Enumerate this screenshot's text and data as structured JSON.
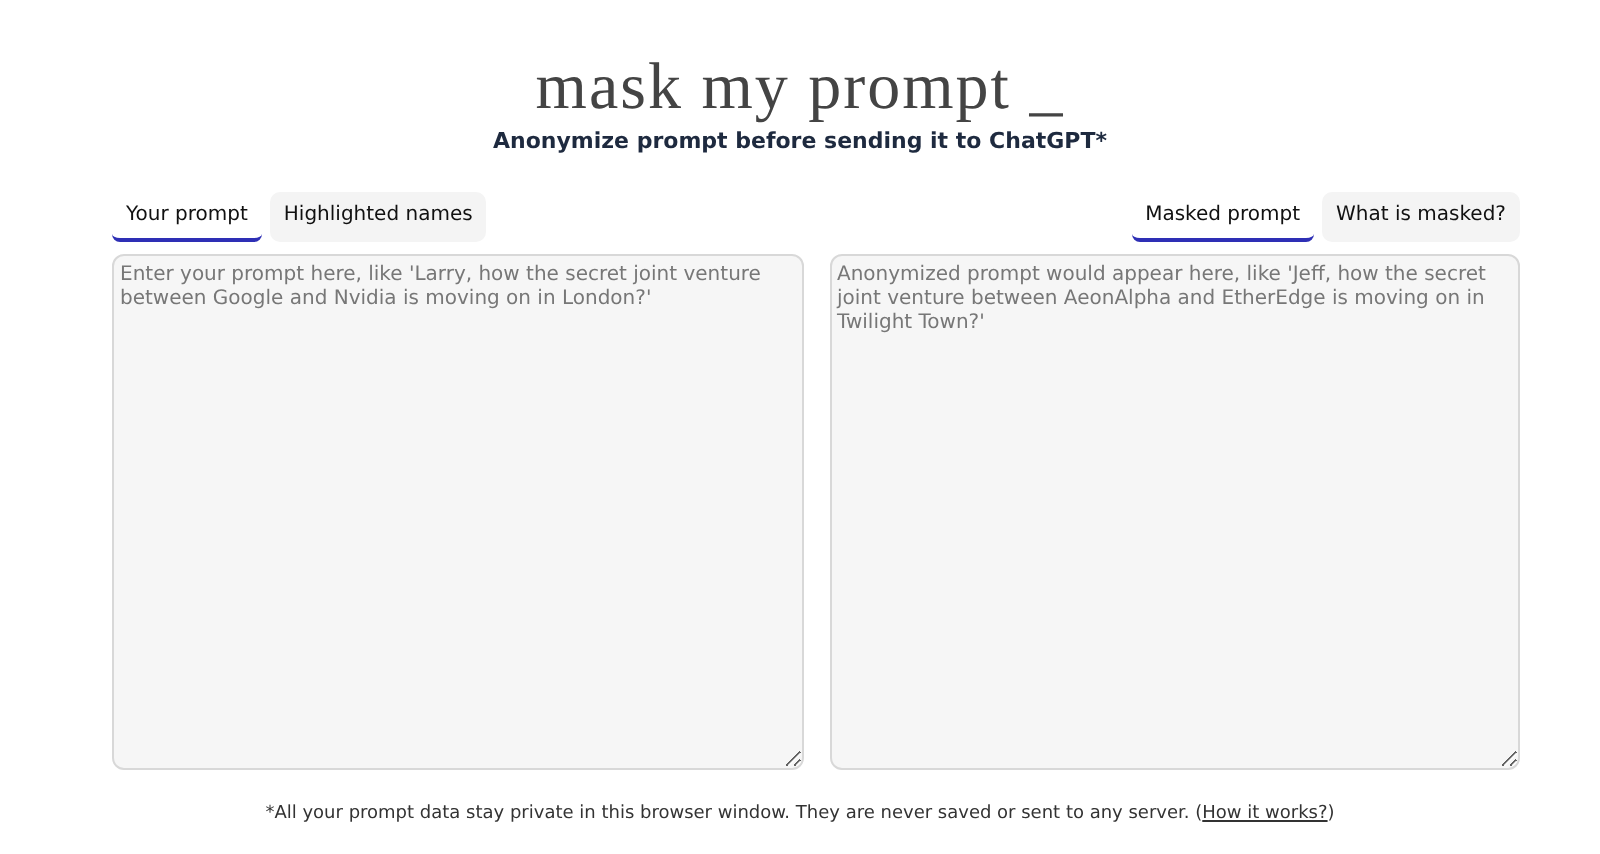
{
  "header": {
    "title": "mask my prompt _",
    "subtitle": "Anonymize prompt before sending it to ChatGPT*"
  },
  "panels": [
    {
      "tabs": [
        {
          "label": "Your prompt",
          "selected": true
        },
        {
          "label": "Highlighted names",
          "selected": false
        }
      ],
      "field": {
        "placeholder": "Enter your prompt here, like 'Larry, how the secret joint venture between Google and Nvidia is moving on in London?'"
      }
    },
    {
      "tabs": [
        {
          "label": "Masked prompt",
          "selected": true
        },
        {
          "label": "What is masked?",
          "selected": false
        }
      ],
      "field": {
        "placeholder": "Anonymized prompt would appear here, like 'Jeff, how the secret joint venture between AeonAlpha and EtherEdge is moving on in Twilight Town?'"
      }
    }
  ],
  "footer": {
    "note": "*All your prompt data stay private in this browser window. They are never saved or sent to any server. (",
    "link": "How it works?",
    "note_end": ")"
  }
}
